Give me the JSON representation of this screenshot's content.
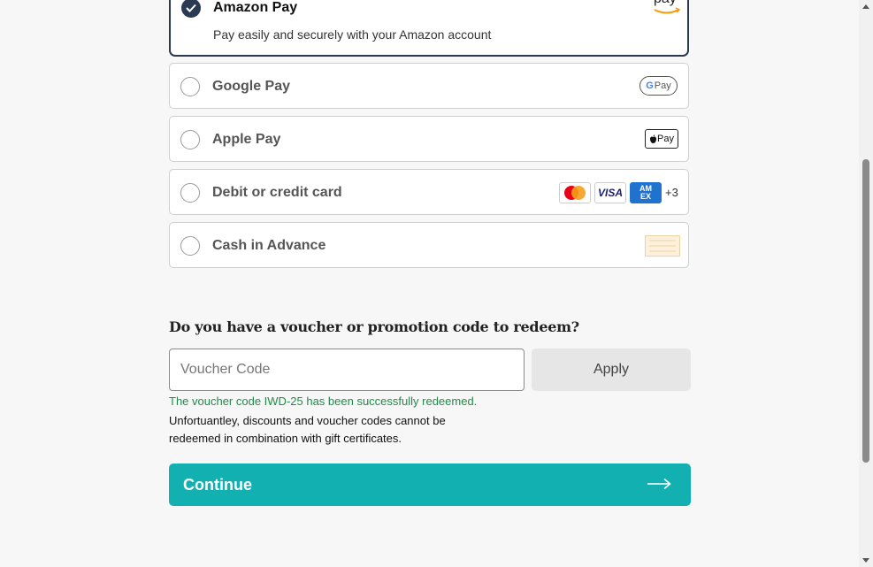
{
  "payment_options": [
    {
      "label": "Amazon Pay",
      "description": "Pay easily and securely with your Amazon account",
      "selected": true,
      "logo": "amazon-pay-logo",
      "logo_text": "pay"
    },
    {
      "label": "Google Pay",
      "selected": false,
      "logo": "google-pay-logo",
      "logo_g": "G",
      "logo_text": "Pay"
    },
    {
      "label": "Apple Pay",
      "selected": false,
      "logo": "apple-pay-logo",
      "logo_text": "Pay"
    },
    {
      "label": "Debit or credit card",
      "selected": false,
      "logo": "card-logos",
      "visa_text": "VISA",
      "amex_text": "AM EX",
      "more_text": "+3"
    },
    {
      "label": "Cash in Advance",
      "selected": false,
      "logo": "cash-logo"
    }
  ],
  "voucher": {
    "heading": "Do you have a voucher or promotion code to redeem?",
    "placeholder": "Voucher Code",
    "value": "",
    "apply_label": "Apply",
    "success_message": "The voucher code IWD-25 has been successfully redeemed.",
    "warning_message": "Unfortuantley, discounts and voucher codes cannot be redeemed in combination with gift certificates."
  },
  "continue_label": "Continue",
  "colors": {
    "accent": "#12b0b0",
    "selected_border": "#2b3a52",
    "success": "#218a4b"
  }
}
